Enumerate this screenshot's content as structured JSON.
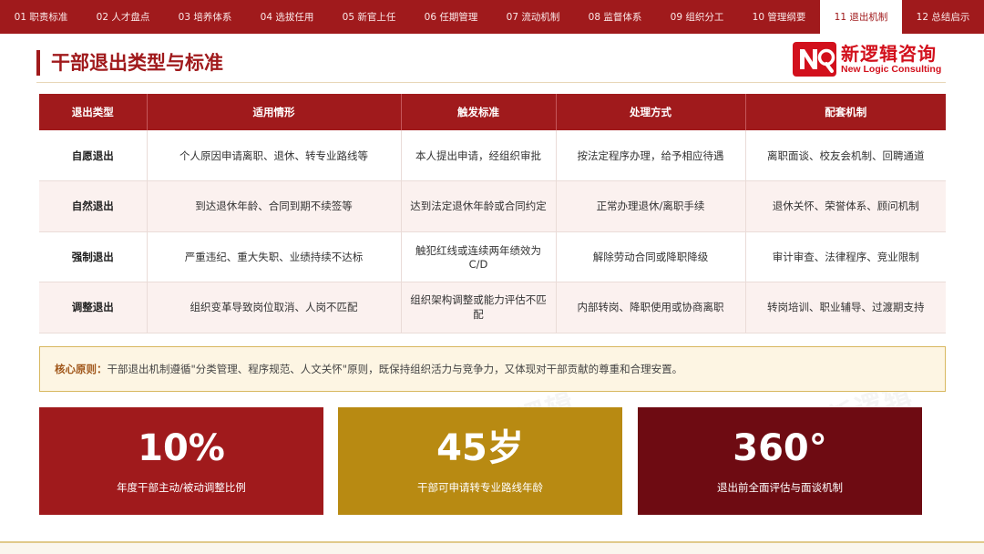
{
  "nav": {
    "tabs": [
      {
        "label": "01 职责标准"
      },
      {
        "label": "02 人才盘点"
      },
      {
        "label": "03 培养体系"
      },
      {
        "label": "04 选拔任用"
      },
      {
        "label": "05 新官上任"
      },
      {
        "label": "06 任期管理"
      },
      {
        "label": "07 流动机制"
      },
      {
        "label": "08 监督体系"
      },
      {
        "label": "09 组织分工"
      },
      {
        "label": "10 管理纲要"
      },
      {
        "label": "11 退出机制"
      },
      {
        "label": "12 总结启示"
      }
    ],
    "active_index": 10
  },
  "page": {
    "title": "干部退出类型与标准"
  },
  "logo": {
    "cn": "新逻辑咨询",
    "en": "New Logic Consulting"
  },
  "table": {
    "headers": [
      "退出类型",
      "适用情形",
      "触发标准",
      "处理方式",
      "配套机制"
    ],
    "rows": [
      {
        "type": "自愿退出",
        "case": "个人原因申请离职、退休、转专业路线等",
        "trigger": "本人提出申请，经组织审批",
        "handling": "按法定程序办理，给予相应待遇",
        "support": "离职面谈、校友会机制、回聘通道"
      },
      {
        "type": "自然退出",
        "case": "到达退休年龄、合同到期不续签等",
        "trigger": "达到法定退休年龄或合同约定",
        "handling": "正常办理退休/离职手续",
        "support": "退休关怀、荣誉体系、顾问机制"
      },
      {
        "type": "强制退出",
        "case": "严重违纪、重大失职、业绩持续不达标",
        "trigger": "触犯红线或连续两年绩效为C/D",
        "handling": "解除劳动合同或降职降级",
        "support": "审计审查、法律程序、竞业限制"
      },
      {
        "type": "调整退出",
        "case": "组织变革导致岗位取消、人岗不匹配",
        "trigger": "组织架构调整或能力评估不匹配",
        "handling": "内部转岗、降职使用或协商离职",
        "support": "转岗培训、职业辅导、过渡期支持"
      }
    ]
  },
  "principle": {
    "label": "核心原则：",
    "text": "干部退出机制遵循\"分类管理、程序规范、人文关怀\"原则，既保持组织活力与竞争力，又体现对干部贡献的尊重和合理安置。"
  },
  "stats": [
    {
      "value": "10%",
      "label": "年度干部主动/被动调整比例"
    },
    {
      "value": "45岁",
      "label": "干部可申请转专业路线年龄"
    },
    {
      "value": "360°",
      "label": "退出前全面评估与面谈机制"
    }
  ],
  "watermark": "HR新逻辑",
  "colors": {
    "primary": "#a01a1c",
    "gold": "#b88a12",
    "dark": "#6e0b12"
  }
}
